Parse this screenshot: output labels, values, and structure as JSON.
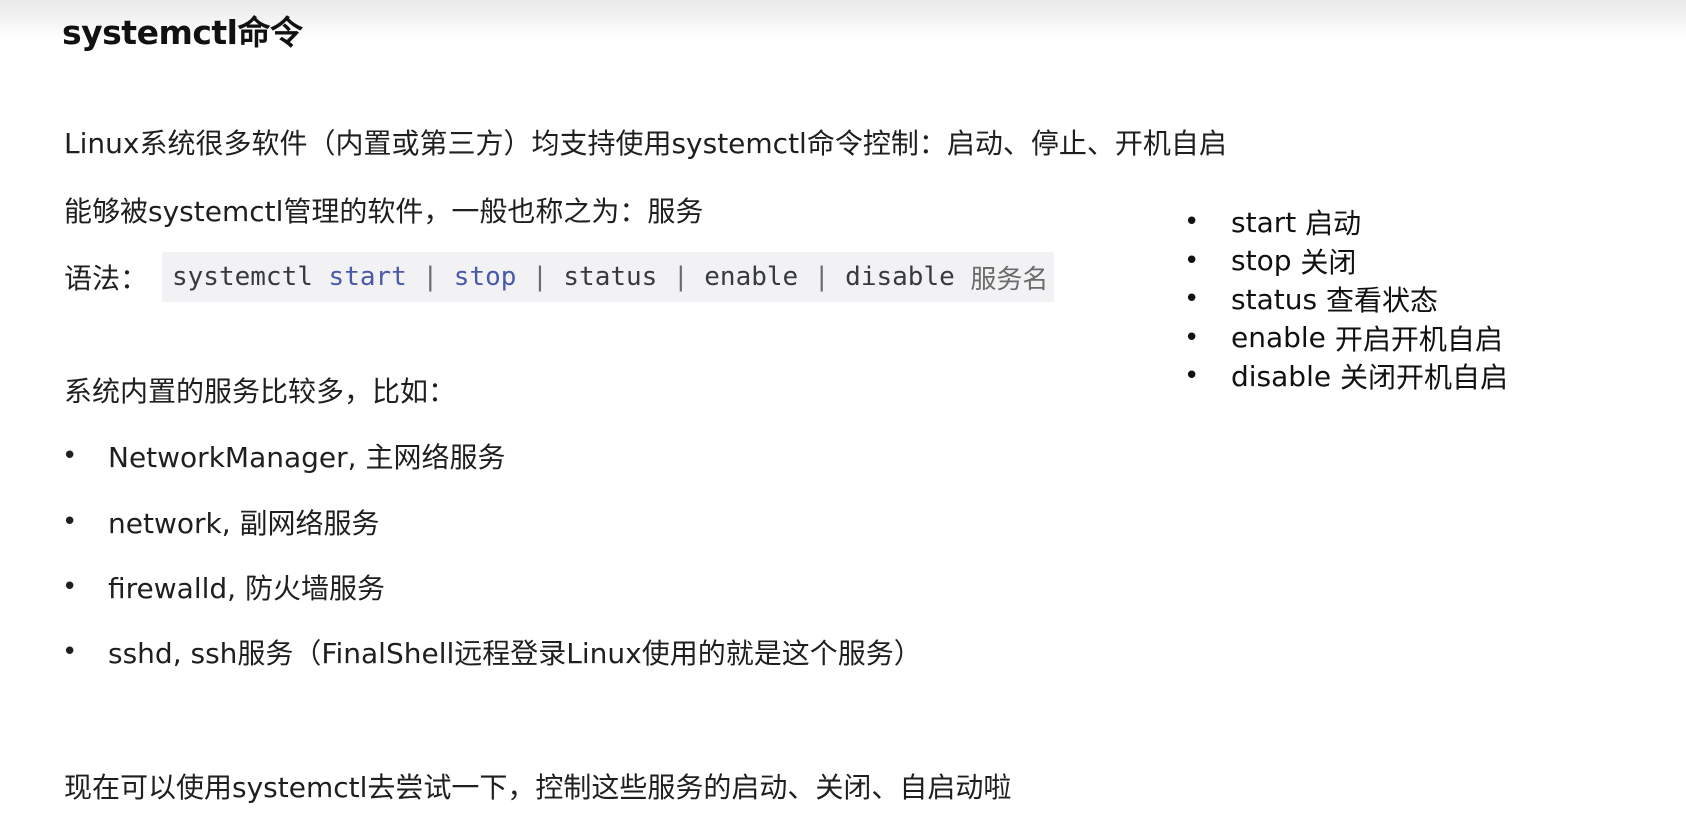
{
  "title": "systemctl命令",
  "intro": "Linux系统很多软件（内置或第三方）均支持使用systemctl命令控制：启动、停止、开机自启",
  "managed_note": "能够被systemctl管理的软件，一般也称之为：服务",
  "syntax": {
    "label": "语法：",
    "command": "systemctl",
    "start": "start",
    "stop": "stop",
    "status": "status",
    "enable": "enable",
    "disable": "disable",
    "separator": "|",
    "argument": "服务名"
  },
  "side_actions": [
    {
      "cmd": "start",
      "desc": "启动"
    },
    {
      "cmd": "stop",
      "desc": "关闭"
    },
    {
      "cmd": "status",
      "desc": "查看状态"
    },
    {
      "cmd": "enable",
      "desc": "开启开机自启"
    },
    {
      "cmd": "disable",
      "desc": "关闭开机自启"
    }
  ],
  "builtin_intro": "系统内置的服务比较多，比如：",
  "services": [
    "NetworkManager, 主网络服务",
    "network, 副网络服务",
    "firewalld, 防火墙服务",
    "sshd, ssh服务（FinalShell远程登录Linux使用的就是这个服务）"
  ],
  "footer": "现在可以使用systemctl去尝试一下，控制这些服务的启动、关闭、自启动啦",
  "bullet_char": "•"
}
